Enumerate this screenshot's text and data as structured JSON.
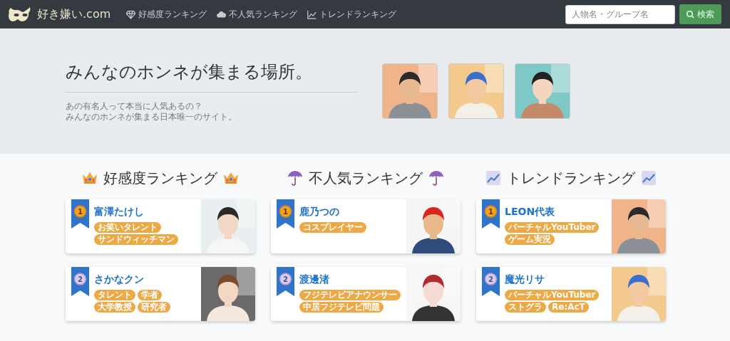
{
  "navbar": {
    "logo": "好き嫌い.com",
    "links": [
      {
        "label": "好感度ランキング"
      },
      {
        "label": "不人気ランキング"
      },
      {
        "label": "トレンドランキング"
      }
    ],
    "search": {
      "placeholder": "人物名・グループ名",
      "button": "検索"
    }
  },
  "hero": {
    "title": "みんなのホンネが集まる場所。",
    "lines": [
      "あの有名人って本当に人気あるの？",
      "みんなのホンネが集まる日本唯一のサイト。"
    ]
  },
  "rankings": [
    {
      "title": "好感度ランキング",
      "items": [
        {
          "rank": "1",
          "kind": "gold",
          "name": "富澤たけし",
          "tags": [
            "お笑いタレント",
            "サンドウィッチマン"
          ]
        },
        {
          "rank": "2",
          "kind": "silver",
          "name": "さかなクン",
          "tags": [
            "タレント",
            "学者",
            "大学教授",
            "研究者"
          ]
        }
      ]
    },
    {
      "title": "不人気ランキング",
      "items": [
        {
          "rank": "1",
          "kind": "gold",
          "name": "鹿乃つの",
          "tags": [
            "コスプレイヤー"
          ]
        },
        {
          "rank": "2",
          "kind": "silver",
          "name": "渡邊渚",
          "tags": [
            "フジテレビアナウンサー",
            "中居フジテレビ問題"
          ]
        }
      ]
    },
    {
      "title": "トレンドランキング",
      "items": [
        {
          "rank": "1",
          "kind": "gold",
          "name": "LEON代表",
          "tags": [
            "バーチャルYouTuber",
            "ゲーム実況"
          ]
        },
        {
          "rank": "2",
          "kind": "silver",
          "name": "魔光リサ",
          "tags": [
            "バーチャルYouTuber",
            "ストグラ",
            "Re:AcT"
          ]
        }
      ]
    }
  ]
}
